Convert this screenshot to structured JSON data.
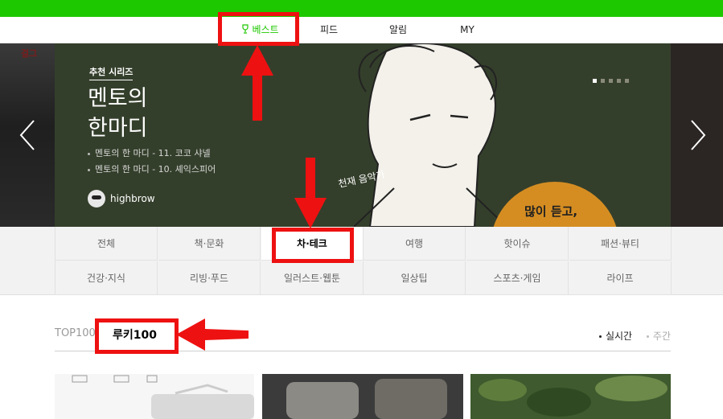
{
  "nav": {
    "best": "베스트",
    "feed": "피드",
    "alarm": "알림",
    "my": "MY"
  },
  "banner": {
    "series_label": "추천 시리즈",
    "title_line1": "멘토의",
    "title_line2": "한마디",
    "links": [
      "멘토의 한 마디 - 11. 코코 샤넬",
      "멘토의 한 마디 - 10. 셰익스피어"
    ],
    "author": "highbrow",
    "illust_caption": "천재 음악가",
    "bubble_text": "많이 듣고,",
    "left_sign": "걸그"
  },
  "categories": [
    [
      "전체",
      "책·문화",
      "차·테크",
      "여행",
      "핫이슈",
      "패션·뷰티"
    ],
    [
      "건강·지식",
      "리빙·푸드",
      "일러스트·웹툰",
      "일상팁",
      "스포츠·게임",
      "라이프"
    ]
  ],
  "active_category": "차·테크",
  "ranking": {
    "tab_top100": "TOP100",
    "tab_rookie": "루키100",
    "period_realtime": "실시간",
    "period_weekly": "주간"
  },
  "colors": {
    "brand_green": "#1ec800",
    "highlight_red": "#ee1111"
  }
}
